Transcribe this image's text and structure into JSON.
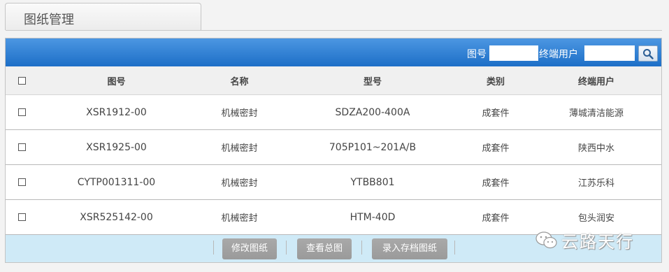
{
  "tab": {
    "title": "图纸管理"
  },
  "search": {
    "drawing_no_label": "图号",
    "drawing_no_value": "",
    "end_user_label": "终端用户",
    "end_user_value": ""
  },
  "table": {
    "columns": [
      "图号",
      "名称",
      "型号",
      "类别",
      "终端用户"
    ],
    "rows": [
      [
        "XSR1912-00",
        "机械密封",
        "SDZA200-400A",
        "成套件",
        "薄城清洁能源"
      ],
      [
        "XSR1925-00",
        "机械密封",
        "705P101~201A/B",
        "成套件",
        "陕西中水"
      ],
      [
        "CYTP001311-00",
        "机械密封",
        "YTBB801",
        "成套件",
        "江苏乐科"
      ],
      [
        "XSR525142-00",
        "机械密封",
        "HTM-40D",
        "成套件",
        "包头润安"
      ]
    ]
  },
  "actions": {
    "edit_label": "修改图纸",
    "view_label": "查看总图",
    "archive_label": "录入存档图纸"
  },
  "watermark": {
    "text": "云路天行"
  },
  "colors": {
    "header_blue": "#1d6fc7",
    "footer_bar": "#cfeaf7",
    "button_gray": "#a3a3a3"
  },
  "icons": {
    "search": "magnifier-icon",
    "watermark": "wechat-icon"
  }
}
